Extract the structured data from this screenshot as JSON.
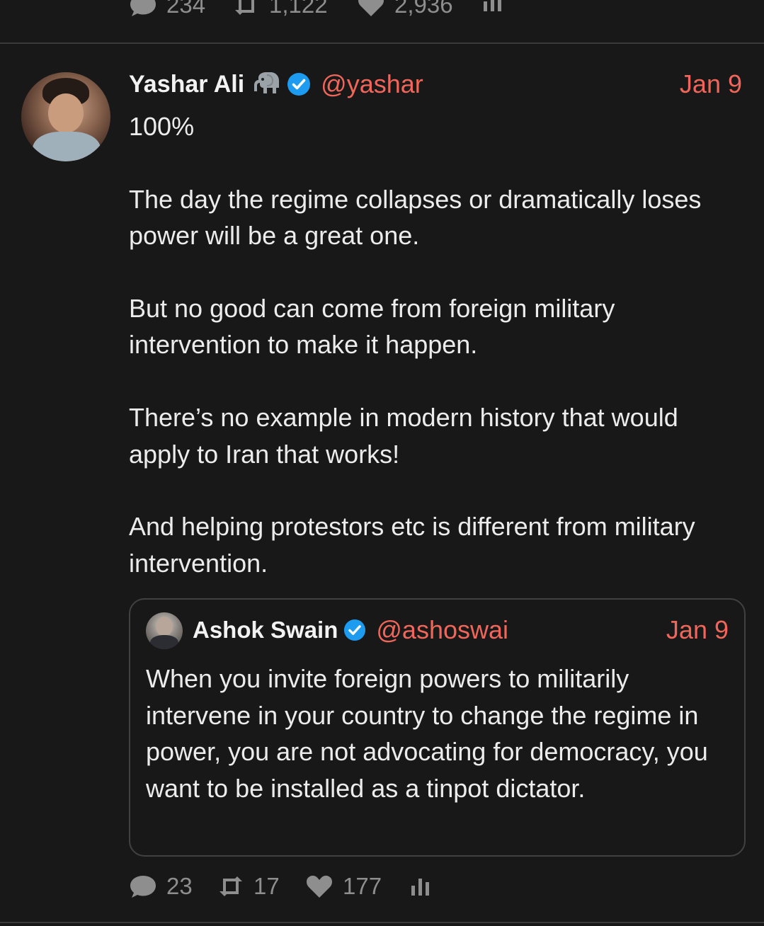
{
  "previous_tweet": {
    "stats": {
      "replies": "234",
      "retweets": "1,122",
      "likes": "2,936"
    }
  },
  "tweet": {
    "author": {
      "name": "Yashar Ali",
      "emoji": "elephant-emoji",
      "verified": true,
      "handle": "@yashar"
    },
    "date": "Jan 9",
    "text": "100%\n\nThe day the regime collapses or dramatically loses power will be a great one.\n\nBut no good can come from foreign military intervention to make it happen.\n\nThere’s no example in modern history that would apply to Iran that works!\n\nAnd helping protestors etc is different from military intervention.",
    "quote": {
      "author": {
        "name": "Ashok Swain",
        "verified": true,
        "handle": "@ashoswai"
      },
      "date": "Jan 9",
      "text": "When you invite foreign powers to militarily intervene in your country to change the regime in power, you are not advocating for democracy, you want to be installed as a tinpot dictator."
    },
    "stats": {
      "replies": "23",
      "retweets": "17",
      "likes": "177"
    }
  },
  "colors": {
    "background": "#181818",
    "accent": "#f0665a",
    "muted": "#8e8e8e",
    "verified": "#1d9bf0",
    "divider": "#3a3a3a"
  },
  "icons": {
    "reply": "reply-icon",
    "retweet": "retweet-icon",
    "like": "heart-icon",
    "analytics": "analytics-icon",
    "verified": "verified-badge-icon"
  }
}
